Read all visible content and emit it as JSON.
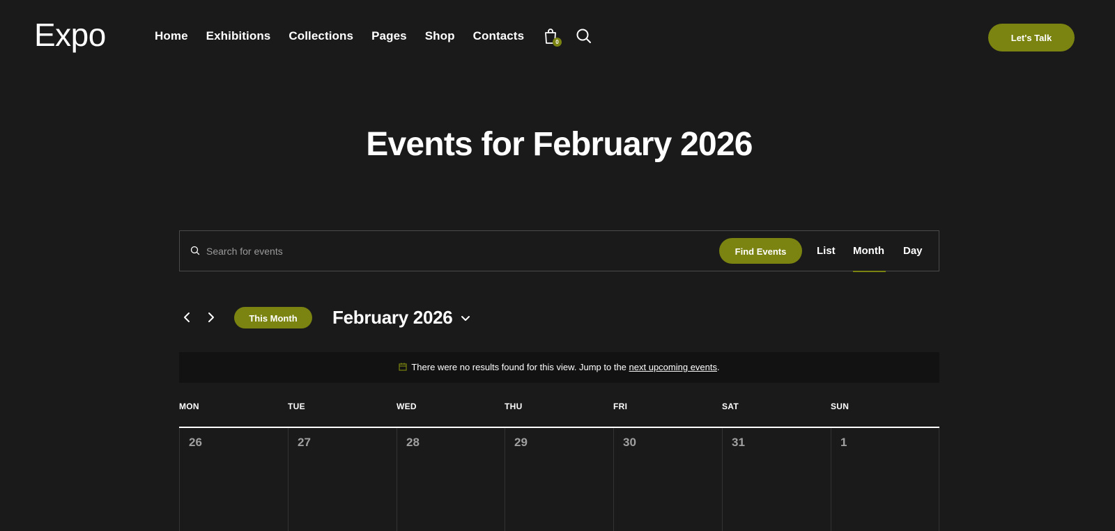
{
  "header": {
    "logo": "Expo",
    "nav": [
      "Home",
      "Exhibitions",
      "Collections",
      "Pages",
      "Shop",
      "Contacts"
    ],
    "cart_count": "0",
    "cta_label": "Let's Talk"
  },
  "page": {
    "title": "Events for February 2026"
  },
  "search": {
    "placeholder": "Search for events",
    "button_label": "Find Events",
    "views": [
      "List",
      "Month",
      "Day"
    ],
    "active_view": "Month"
  },
  "calendar_nav": {
    "this_month_label": "This Month",
    "current_month": "February 2026"
  },
  "notice": {
    "text": "There were no results found for this view. Jump to the",
    "link": "next upcoming events",
    "suffix": "."
  },
  "calendar": {
    "weekdays": [
      "MON",
      "TUE",
      "WED",
      "THU",
      "FRI",
      "SAT",
      "SUN"
    ],
    "first_week": [
      "26",
      "27",
      "28",
      "29",
      "30",
      "31",
      "1"
    ]
  },
  "colors": {
    "background": "#1a1a1a",
    "accent": "#7b8410",
    "notice_bg": "#121212",
    "muted_text": "#a0a0a0"
  }
}
